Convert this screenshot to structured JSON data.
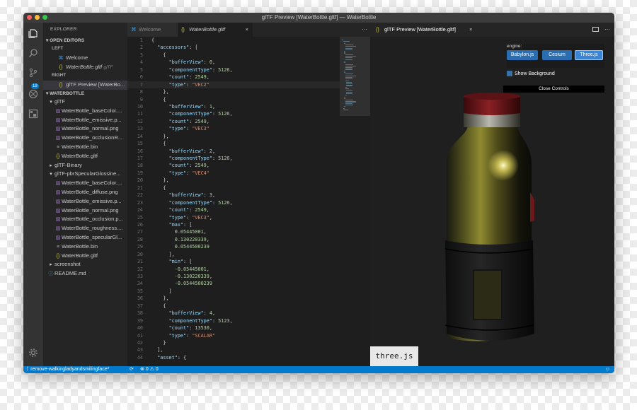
{
  "window": {
    "title": "glTF Preview [WaterBottle.gltf] — WaterBottle"
  },
  "explorer": {
    "title": "EXPLORER",
    "open_editors": {
      "header": "OPEN EDITORS",
      "left_group": "LEFT",
      "right_group": "RIGHT",
      "left_items": [
        {
          "icon": "vscode-icon",
          "label": "Welcome",
          "suffix": ""
        },
        {
          "icon": "json-icon",
          "label": "WaterBottle.gltf",
          "suffix": "glTF"
        }
      ],
      "right_items": [
        {
          "icon": "json-icon",
          "label": "glTF Preview [WaterBo..."
        }
      ]
    },
    "folder": {
      "header": "WATERBOTTLE",
      "tree": [
        {
          "depth": 0,
          "type": "folder-open",
          "label": "glTF"
        },
        {
          "depth": 1,
          "type": "image",
          "label": "WaterBottle_baseColor...."
        },
        {
          "depth": 1,
          "type": "image",
          "label": "WaterBottle_emissive.p..."
        },
        {
          "depth": 1,
          "type": "image",
          "label": "WaterBottle_normal.png"
        },
        {
          "depth": 1,
          "type": "image",
          "label": "WaterBottle_occlusionR..."
        },
        {
          "depth": 1,
          "type": "bin",
          "label": "WaterBottle.bin"
        },
        {
          "depth": 1,
          "type": "json",
          "label": "WaterBottle.gltf"
        },
        {
          "depth": 0,
          "type": "folder-closed",
          "label": "glTF-Binary"
        },
        {
          "depth": 0,
          "type": "folder-open",
          "label": "glTF-pbrSpecularGlossine..."
        },
        {
          "depth": 1,
          "type": "image",
          "label": "WaterBottle_baseColor...."
        },
        {
          "depth": 1,
          "type": "image",
          "label": "WaterBottle_diffuse.png"
        },
        {
          "depth": 1,
          "type": "image",
          "label": "WaterBottle_emissive.p..."
        },
        {
          "depth": 1,
          "type": "image",
          "label": "WaterBottle_normal.png"
        },
        {
          "depth": 1,
          "type": "image",
          "label": "WaterBottle_occlusion.p..."
        },
        {
          "depth": 1,
          "type": "image",
          "label": "WaterBottle_roughness...."
        },
        {
          "depth": 1,
          "type": "image",
          "label": "WaterBottle_specularGl..."
        },
        {
          "depth": 1,
          "type": "bin",
          "label": "WaterBottle.bin"
        },
        {
          "depth": 1,
          "type": "json",
          "label": "WaterBottle.gltf"
        },
        {
          "depth": 0,
          "type": "folder-closed",
          "label": "screenshot"
        },
        {
          "depth": 0,
          "type": "info",
          "label": "README.md"
        }
      ]
    }
  },
  "activity_bar": {
    "scm_badge": "19"
  },
  "editor": {
    "tabs": [
      {
        "label": "Welcome",
        "icon": "vscode-icon"
      },
      {
        "label": "WaterBottle.gltf",
        "icon": "json-icon",
        "close": "×"
      }
    ],
    "more": "···",
    "current_line": 7,
    "lines": [
      [
        [
          "p",
          "{"
        ]
      ],
      [
        [
          "p",
          "  "
        ],
        [
          "k",
          "\"accessors\""
        ],
        [
          "p",
          ": ["
        ]
      ],
      [
        [
          "p",
          "    {"
        ]
      ],
      [
        [
          "p",
          "      "
        ],
        [
          "k",
          "\"bufferView\""
        ],
        [
          "p",
          ": "
        ],
        [
          "n",
          "0"
        ],
        [
          "p",
          ","
        ]
      ],
      [
        [
          "p",
          "      "
        ],
        [
          "k",
          "\"componentType\""
        ],
        [
          "p",
          ": "
        ],
        [
          "n",
          "5126"
        ],
        [
          "p",
          ","
        ]
      ],
      [
        [
          "p",
          "      "
        ],
        [
          "k",
          "\"count\""
        ],
        [
          "p",
          ": "
        ],
        [
          "n",
          "2549"
        ],
        [
          "p",
          ","
        ]
      ],
      [
        [
          "p",
          "      "
        ],
        [
          "k",
          "\"type\""
        ],
        [
          "p",
          ": "
        ],
        [
          "s",
          "\"VEC2\""
        ]
      ],
      [
        [
          "p",
          "    },"
        ]
      ],
      [
        [
          "p",
          "    {"
        ]
      ],
      [
        [
          "p",
          "      "
        ],
        [
          "k",
          "\"bufferView\""
        ],
        [
          "p",
          ": "
        ],
        [
          "n",
          "1"
        ],
        [
          "p",
          ","
        ]
      ],
      [
        [
          "p",
          "      "
        ],
        [
          "k",
          "\"componentType\""
        ],
        [
          "p",
          ": "
        ],
        [
          "n",
          "5126"
        ],
        [
          "p",
          ","
        ]
      ],
      [
        [
          "p",
          "      "
        ],
        [
          "k",
          "\"count\""
        ],
        [
          "p",
          ": "
        ],
        [
          "n",
          "2549"
        ],
        [
          "p",
          ","
        ]
      ],
      [
        [
          "p",
          "      "
        ],
        [
          "k",
          "\"type\""
        ],
        [
          "p",
          ": "
        ],
        [
          "s",
          "\"VEC3\""
        ]
      ],
      [
        [
          "p",
          "    },"
        ]
      ],
      [
        [
          "p",
          "    {"
        ]
      ],
      [
        [
          "p",
          "      "
        ],
        [
          "k",
          "\"bufferView\""
        ],
        [
          "p",
          ": "
        ],
        [
          "n",
          "2"
        ],
        [
          "p",
          ","
        ]
      ],
      [
        [
          "p",
          "      "
        ],
        [
          "k",
          "\"componentType\""
        ],
        [
          "p",
          ": "
        ],
        [
          "n",
          "5126"
        ],
        [
          "p",
          ","
        ]
      ],
      [
        [
          "p",
          "      "
        ],
        [
          "k",
          "\"count\""
        ],
        [
          "p",
          ": "
        ],
        [
          "n",
          "2549"
        ],
        [
          "p",
          ","
        ]
      ],
      [
        [
          "p",
          "      "
        ],
        [
          "k",
          "\"type\""
        ],
        [
          "p",
          ": "
        ],
        [
          "s",
          "\"VEC4\""
        ]
      ],
      [
        [
          "p",
          "    },"
        ]
      ],
      [
        [
          "p",
          "    {"
        ]
      ],
      [
        [
          "p",
          "      "
        ],
        [
          "k",
          "\"bufferView\""
        ],
        [
          "p",
          ": "
        ],
        [
          "n",
          "3"
        ],
        [
          "p",
          ","
        ]
      ],
      [
        [
          "p",
          "      "
        ],
        [
          "k",
          "\"componentType\""
        ],
        [
          "p",
          ": "
        ],
        [
          "n",
          "5126"
        ],
        [
          "p",
          ","
        ]
      ],
      [
        [
          "p",
          "      "
        ],
        [
          "k",
          "\"count\""
        ],
        [
          "p",
          ": "
        ],
        [
          "n",
          "2549"
        ],
        [
          "p",
          ","
        ]
      ],
      [
        [
          "p",
          "      "
        ],
        [
          "k",
          "\"type\""
        ],
        [
          "p",
          ": "
        ],
        [
          "s",
          "\"VEC3\""
        ],
        [
          "p",
          ","
        ]
      ],
      [
        [
          "p",
          "      "
        ],
        [
          "k",
          "\"max\""
        ],
        [
          "p",
          ": ["
        ]
      ],
      [
        [
          "p",
          "        "
        ],
        [
          "n",
          "0.05445001"
        ],
        [
          "p",
          ","
        ]
      ],
      [
        [
          "p",
          "        "
        ],
        [
          "n",
          "0.130220339"
        ],
        [
          "p",
          ","
        ]
      ],
      [
        [
          "p",
          "        "
        ],
        [
          "n",
          "0.0544500239"
        ]
      ],
      [
        [
          "p",
          "      ],"
        ]
      ],
      [
        [
          "p",
          "      "
        ],
        [
          "k",
          "\"min\""
        ],
        [
          "p",
          ": ["
        ]
      ],
      [
        [
          "p",
          "        "
        ],
        [
          "n",
          "-0.05445001"
        ],
        [
          "p",
          ","
        ]
      ],
      [
        [
          "p",
          "        "
        ],
        [
          "n",
          "-0.130220339"
        ],
        [
          "p",
          ","
        ]
      ],
      [
        [
          "p",
          "        "
        ],
        [
          "n",
          "-0.0544500239"
        ]
      ],
      [
        [
          "p",
          "      ]"
        ]
      ],
      [
        [
          "p",
          "    },"
        ]
      ],
      [
        [
          "p",
          "    {"
        ]
      ],
      [
        [
          "p",
          "      "
        ],
        [
          "k",
          "\"bufferView\""
        ],
        [
          "p",
          ": "
        ],
        [
          "n",
          "4"
        ],
        [
          "p",
          ","
        ]
      ],
      [
        [
          "p",
          "      "
        ],
        [
          "k",
          "\"componentType\""
        ],
        [
          "p",
          ": "
        ],
        [
          "n",
          "5123"
        ],
        [
          "p",
          ","
        ]
      ],
      [
        [
          "p",
          "      "
        ],
        [
          "k",
          "\"count\""
        ],
        [
          "p",
          ": "
        ],
        [
          "n",
          "13530"
        ],
        [
          "p",
          ","
        ]
      ],
      [
        [
          "p",
          "      "
        ],
        [
          "k",
          "\"type\""
        ],
        [
          "p",
          ": "
        ],
        [
          "s",
          "\"SCALAR\""
        ]
      ],
      [
        [
          "p",
          "    }"
        ]
      ],
      [
        [
          "p",
          "  ],"
        ]
      ],
      [
        [
          "p",
          "  "
        ],
        [
          "k",
          "\"asset\""
        ],
        [
          "p",
          ": {"
        ]
      ]
    ]
  },
  "preview": {
    "tab_label": "glTF Preview [WaterBottle.gltf]",
    "engine_label": "engine:",
    "engines": [
      "Babylon.js",
      "Cesium",
      "Three.js"
    ],
    "selected_engine": "Three.js",
    "show_background": "Show Background",
    "close_controls": "Close Controls",
    "renderer_tag": "three.js"
  },
  "statusbar": {
    "branch": "remove-walkingladyandsmilingface*",
    "errors": "0",
    "warnings": "0",
    "feedback_icon": "smiley-icon"
  },
  "colors": {
    "accent": "#007acc",
    "selected_engine": "#2a6db0",
    "cap": "#7a1a1e"
  }
}
